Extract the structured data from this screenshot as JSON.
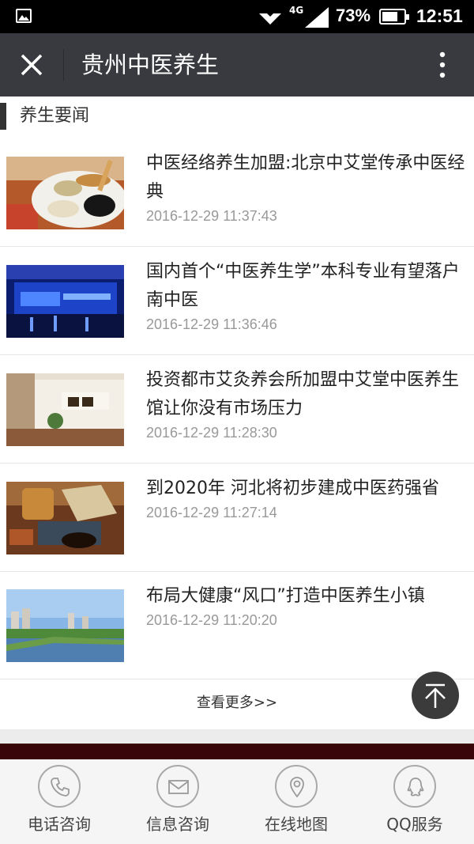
{
  "status_bar": {
    "network": "4G",
    "battery": "73%",
    "battery_level": 0.73,
    "time": "12:51"
  },
  "header": {
    "title": "贵州中医养生",
    "close_icon": "close-icon",
    "more_icon": "more-vertical-icon"
  },
  "section": {
    "title": "养生要闻"
  },
  "news": [
    {
      "title": "中医经络养生加盟:北京中艾堂传承中医经典",
      "time": "2016-12-29 11:37:43",
      "thumb": "herbs-plate"
    },
    {
      "title": "国内首个“中医养生学”本科专业有望落户南中医",
      "time": "2016-12-29 11:36:46",
      "thumb": "stage-event"
    },
    {
      "title": "投资都市艾灸养会所加盟中艾堂中医养生馆让你没有市场压力",
      "time": "2016-12-29 11:28:30",
      "thumb": "clinic-reception"
    },
    {
      "title": "到2020年 河北将初步建成中医药强省",
      "time": "2016-12-29 11:27:14",
      "thumb": "herbal-medicine"
    },
    {
      "title": "布局大健康“风口”打造中医养生小镇",
      "time": "2016-12-29 11:20:20",
      "thumb": "river-town"
    }
  ],
  "more_link": "查看更多>>",
  "back_to_top_icon": "arrow-up-icon",
  "bottom_nav": [
    {
      "label": "电话咨询",
      "icon": "phone-icon"
    },
    {
      "label": "信息咨询",
      "icon": "mail-icon"
    },
    {
      "label": "在线地图",
      "icon": "map-pin-icon"
    },
    {
      "label": "QQ服务",
      "icon": "qq-icon"
    }
  ],
  "colors": {
    "header_bg": "#393a3f",
    "status_bg": "#000000",
    "footer_band": "#3a0509",
    "time_text": "#999999"
  }
}
